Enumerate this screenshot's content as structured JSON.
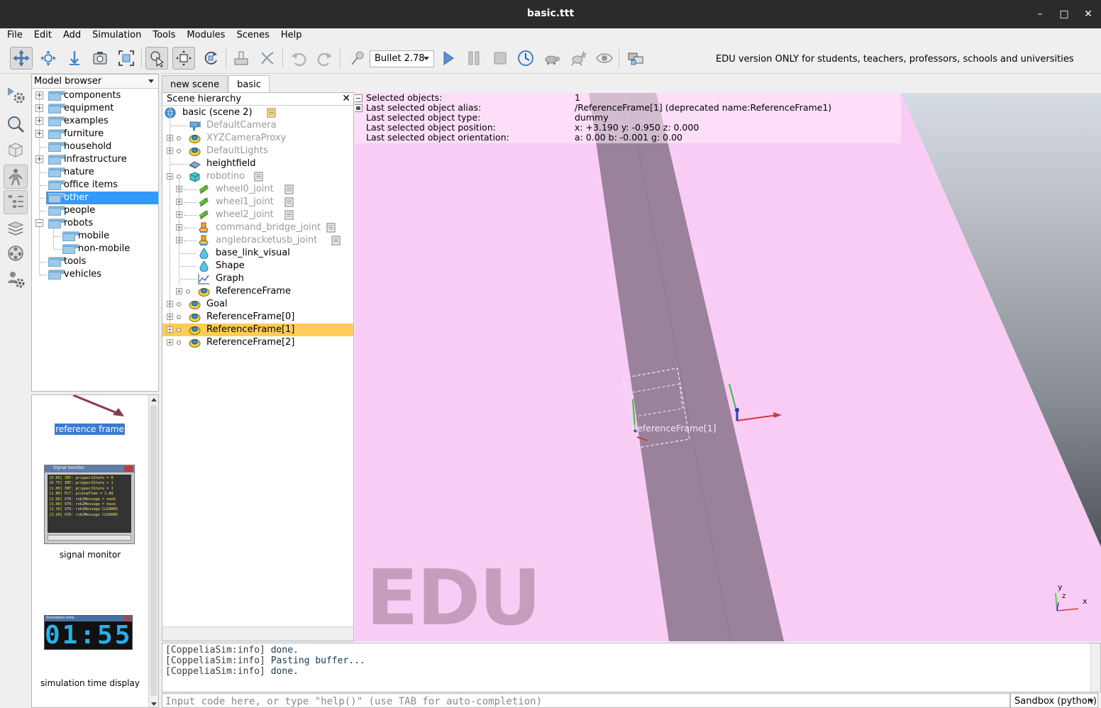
{
  "window": {
    "title": "basic.ttt",
    "minimize_glyph": "–",
    "maximize_glyph": "□",
    "close_glyph": "✕"
  },
  "menu": [
    "File",
    "Edit",
    "Add",
    "Simulation",
    "Tools",
    "Modules",
    "Scenes",
    "Help"
  ],
  "toolbar": {
    "icons": [
      "move-camera-icon",
      "rotate-camera-icon",
      "zoom-camera-icon",
      "camera-angle-icon",
      "fit-to-view-icon",
      "click-selection-icon",
      "object-shift-icon",
      "object-rotate-icon",
      "assemble-icon",
      "transfer-dna-icon",
      "undo-icon",
      "redo-icon",
      "dynamics-icon",
      "start-simulation-icon",
      "pause-simulation-icon",
      "stop-simulation-icon",
      "realtime-icon",
      "slow-down-icon",
      "speed-up-icon",
      "visualization-icon",
      "page-selector-icon"
    ],
    "physics_engine": "Bullet 2.78",
    "edu_notice": "EDU version ONLY for students, teachers, professors, schools and universities"
  },
  "leftbar": {
    "icons": [
      "simulation-settings-icon",
      "scripts-icon",
      "shapes-edit-icon",
      "model-browser-icon",
      "scene-hierarchy-icon",
      "layers-icon",
      "video-recorder-icon",
      "user-settings-icon"
    ]
  },
  "model_browser": {
    "header": "Model browser",
    "folders": [
      {
        "label": "components",
        "expandable": true
      },
      {
        "label": "equipment",
        "expandable": true
      },
      {
        "label": "examples",
        "expandable": true
      },
      {
        "label": "furniture",
        "expandable": true
      },
      {
        "label": "household",
        "expandable": false
      },
      {
        "label": "infrastructure",
        "expandable": true
      },
      {
        "label": "nature",
        "expandable": false
      },
      {
        "label": "office items",
        "expandable": false
      },
      {
        "label": "other",
        "expandable": false,
        "selected": true
      },
      {
        "label": "people",
        "expandable": false
      },
      {
        "label": "robots",
        "expandable": true,
        "expanded": true
      },
      {
        "label": "mobile",
        "expandable": false,
        "child": true
      },
      {
        "label": "non-mobile",
        "expandable": false,
        "child": true
      },
      {
        "label": "tools",
        "expandable": false
      },
      {
        "label": "vehicles",
        "expandable": false
      }
    ]
  },
  "thumbnails": [
    {
      "label": "reference frame"
    },
    {
      "label": "signal monitor",
      "window_title": "Signal monitor",
      "lines": [
        "[0.00] INT: gripper1State = 0",
        "[0.75] INT: gripper2State = 1",
        "[1.00] INT: gripper1State = 1",
        "[1.80] FLT: pickupTime = 1.80",
        "[2.90] STR: rob1Message = need",
        "[3.00] STR: rob2Message = have",
        "[3.10] STR: rob1Message CLEARED",
        "[3.20] STR: rob2Message CLEARED"
      ]
    },
    {
      "label": "simulation time display",
      "window_title": "Simulation time",
      "time": "01:55"
    }
  ],
  "scene_tabs": [
    {
      "label": "new scene",
      "active": false
    },
    {
      "label": "basic",
      "active": true
    }
  ],
  "hierarchy": {
    "header": "Scene hierarchy",
    "close_glyph": "✕",
    "items": [
      {
        "label": "basic (scene 2)",
        "icon": "scene-icon",
        "dim": false
      },
      {
        "label": "DefaultCamera",
        "icon": "camera-icon",
        "dim": true
      },
      {
        "label": "XYZCameraProxy",
        "icon": "dummy-icon",
        "dim": true
      },
      {
        "label": "DefaultLights",
        "icon": "dummy-icon",
        "dim": true
      },
      {
        "label": "heightfield",
        "icon": "heightfield-icon",
        "dim": false
      },
      {
        "label": "robotino",
        "icon": "shape-icon",
        "dim": true
      },
      {
        "label": "wheel0_joint",
        "icon": "joint-icon",
        "dim": true
      },
      {
        "label": "wheel1_joint",
        "icon": "joint-icon",
        "dim": true
      },
      {
        "label": "wheel2_joint",
        "icon": "joint-icon",
        "dim": true
      },
      {
        "label": "command_bridge_joint",
        "icon": "revolute-joint-icon",
        "dim": true
      },
      {
        "label": "anglebracketusb_joint",
        "icon": "revolute-joint-icon",
        "dim": true
      },
      {
        "label": "base_link_visual",
        "icon": "shape-drop-icon",
        "dim": false
      },
      {
        "label": "Shape",
        "icon": "shape-drop-icon",
        "dim": false
      },
      {
        "label": "Graph",
        "icon": "graph-icon",
        "dim": false
      },
      {
        "label": "ReferenceFrame",
        "icon": "dummy-icon",
        "dim": false
      },
      {
        "label": "Goal",
        "icon": "dummy-icon",
        "dim": false
      },
      {
        "label": "ReferenceFrame[0]",
        "icon": "dummy-icon",
        "dim": false
      },
      {
        "label": "ReferenceFrame[1]",
        "icon": "dummy-icon",
        "dim": false,
        "selected": true
      },
      {
        "label": "ReferenceFrame[2]",
        "icon": "dummy-icon",
        "dim": false
      }
    ]
  },
  "viewport": {
    "info_rows": [
      {
        "label": "Selected objects:",
        "value": "1"
      },
      {
        "label": "Last selected object alias:",
        "value": "/ReferenceFrame[1]   (deprecated name:ReferenceFrame1)"
      },
      {
        "label": "Last selected object type:",
        "value": "dummy"
      },
      {
        "label": "Last selected object position:",
        "value": "x: +3.190    y: -0.950    z: 0.000"
      },
      {
        "label": "Last selected object orientation:",
        "value": "a: 0.00    b: -0.001    g: 0.00"
      }
    ],
    "object_label": "ReferenceFrame[1]",
    "watermark": "EDU",
    "axis_labels": {
      "x": "x",
      "y": "y",
      "z": "z"
    }
  },
  "console": {
    "lines": [
      {
        "prefix": "[CoppeliaSim:info]",
        "text": "done."
      },
      {
        "prefix": "[CoppeliaSim:info]",
        "text": "Pasting buffer..."
      },
      {
        "prefix": "[CoppeliaSim:info]",
        "text": "done."
      }
    ],
    "input_placeholder": "Input code here, or type \"help()\" (use TAB for auto-completion)",
    "sandbox_label": "Sandbox (python)"
  }
}
